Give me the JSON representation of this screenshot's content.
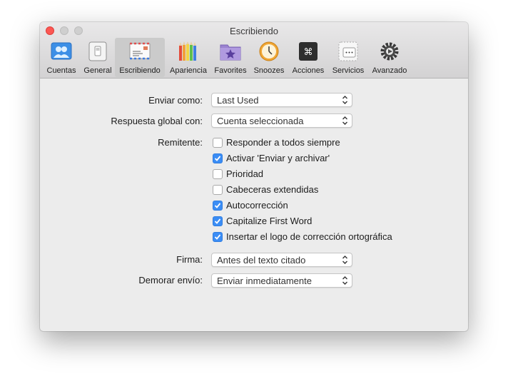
{
  "window": {
    "title": "Escribiendo"
  },
  "toolbar": {
    "items": [
      {
        "label": "Cuentas",
        "icon": "accounts-icon"
      },
      {
        "label": "General",
        "icon": "general-switch-icon"
      },
      {
        "label": "Escribiendo",
        "icon": "envelope-icon",
        "selected": true
      },
      {
        "label": "Apariencia",
        "icon": "colored-pencils-icon"
      },
      {
        "label": "Favorites",
        "icon": "folder-star-icon"
      },
      {
        "label": "Snoozes",
        "icon": "clock-icon"
      },
      {
        "label": "Acciones",
        "icon": "command-key-icon"
      },
      {
        "label": "Servicios",
        "icon": "services-dots-icon"
      },
      {
        "label": "Avanzado",
        "icon": "gear-icon"
      }
    ]
  },
  "form": {
    "send_as": {
      "label": "Enviar como:",
      "value": "Last Used"
    },
    "reply_all": {
      "label": "Respuesta global con:",
      "value": "Cuenta seleccionada"
    },
    "sender": {
      "label": "Remitente:",
      "options": [
        {
          "text": "Responder a todos siempre",
          "checked": false
        },
        {
          "text": "Activar 'Enviar y archivar'",
          "checked": true
        },
        {
          "text": "Prioridad",
          "checked": false
        },
        {
          "text": "Cabeceras extendidas",
          "checked": false
        },
        {
          "text": "Autocorrección",
          "checked": true
        },
        {
          "text": "Capitalize First Word",
          "checked": true
        },
        {
          "text": "Insertar el logo de corrección ortográfica",
          "checked": true
        }
      ]
    },
    "signature": {
      "label": "Firma:",
      "value": "Antes del texto citado"
    },
    "delay_send": {
      "label": "Demorar envío:",
      "value": "Enviar inmediatamente"
    }
  },
  "colors": {
    "accent": "#3b8df5",
    "close": "#fc5753"
  }
}
